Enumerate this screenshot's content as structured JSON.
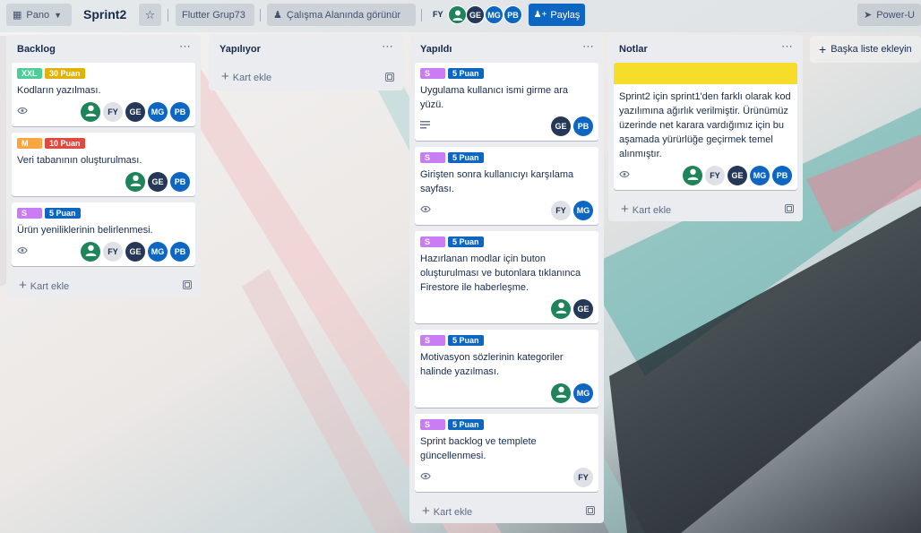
{
  "header": {
    "view_switch": "Pano",
    "board_title": "Sprint2",
    "workspace": "Flutter Grup73",
    "visibility": "Çalışma Alanında görünür",
    "header_members": [
      "FY",
      "",
      "GE",
      "MG",
      "PB"
    ],
    "share_label": "Paylaş",
    "powerups_label": "Power-U"
  },
  "add_list_label": "Başka liste ekleyin",
  "add_card_label": "Kart ekle",
  "lists": [
    {
      "title": "Backlog",
      "cards": [
        {
          "labels": [
            {
              "text": "XXL",
              "color": "#4bce97"
            },
            {
              "text": "30 Puan",
              "color": "#e2b203"
            }
          ],
          "title": "Kodların yazılması.",
          "watch": true,
          "desc": false,
          "members": [
            "green",
            "FY",
            "GE",
            "MG",
            "PB"
          ]
        },
        {
          "labels": [
            {
              "text": "M",
              "color": "#faa53d"
            },
            {
              "text": "10 Puan",
              "color": "#e2483d"
            }
          ],
          "title": "Veri tabanının oluşturulması.",
          "watch": false,
          "desc": false,
          "members": [
            "green",
            "GE",
            "PB"
          ]
        },
        {
          "labels": [
            {
              "text": "S",
              "color": "#c97cf4"
            },
            {
              "text": "5 Puan",
              "color": "#0c66c2"
            }
          ],
          "title": "Ürün yeniliklerinin belirlenmesi.",
          "watch": true,
          "desc": false,
          "members": [
            "green",
            "FY",
            "GE",
            "MG",
            "PB"
          ]
        }
      ]
    },
    {
      "title": "Yapılıyor",
      "cards": []
    },
    {
      "title": "Yapıldı",
      "cards": [
        {
          "labels": [
            {
              "text": "S",
              "color": "#c97cf4"
            },
            {
              "text": "5 Puan",
              "color": "#0c66c2"
            }
          ],
          "title": "Uygulama kullanıcı ismi girme ara yüzü.",
          "watch": false,
          "desc": true,
          "members": [
            "GE",
            "PB"
          ]
        },
        {
          "labels": [
            {
              "text": "S",
              "color": "#c97cf4"
            },
            {
              "text": "5 Puan",
              "color": "#0c66c2"
            }
          ],
          "title": "Girişten sonra kullanıcıyı karşılama sayfası.",
          "watch": true,
          "desc": false,
          "members": [
            "FY",
            "MG"
          ]
        },
        {
          "labels": [
            {
              "text": "S",
              "color": "#c97cf4"
            },
            {
              "text": "5 Puan",
              "color": "#0c66c2"
            }
          ],
          "title": "Hazırlanan modlar için buton oluşturulması ve butonlara tıklanınca Firestore ile haberleşme.",
          "watch": false,
          "desc": false,
          "members": [
            "green",
            "GE"
          ]
        },
        {
          "labels": [
            {
              "text": "S",
              "color": "#c97cf4"
            },
            {
              "text": "5 Puan",
              "color": "#0c66c2"
            }
          ],
          "title": "Motivasyon sözlerinin kategoriler halinde yazılması.",
          "watch": false,
          "desc": false,
          "members": [
            "green",
            "MG"
          ]
        },
        {
          "labels": [
            {
              "text": "S",
              "color": "#c97cf4"
            },
            {
              "text": "5 Puan",
              "color": "#0c66c2"
            }
          ],
          "title": "Sprint backlog ve templete güncellenmesi.",
          "watch": true,
          "desc": false,
          "members": [
            "FY"
          ]
        }
      ]
    },
    {
      "title": "Notlar",
      "cards": [
        {
          "cover": "#f5dd29",
          "labels": [],
          "title": "Sprint2 için sprint1'den farklı olarak kod yazılımına ağırlık verilmiştir. Ürünümüz üzerinde net karara vardığımız için bu aşamada yürürlüğe geçirmek temel alınmıştır.",
          "watch": true,
          "desc": false,
          "members": [
            "green",
            "FY",
            "GE",
            "MG",
            "PB"
          ]
        }
      ]
    }
  ]
}
